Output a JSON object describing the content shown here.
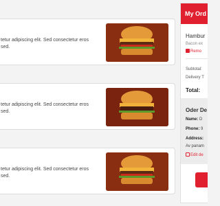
{
  "products": [
    {
      "description": "tetur adipiscing elit. Sed consectetur eros\nsed.",
      "image_icon": "burger-image"
    },
    {
      "description": "tetur adipiscing elit. Sed consectetur eros\nsed.",
      "image_icon": "burger-image"
    },
    {
      "description": "tetur adipiscing elit. Sed consectetur eros\nsed.",
      "image_icon": "burger-image"
    }
  ],
  "order": {
    "title": "My Ord",
    "item_name": "Hambur",
    "item_sub": "Bacon ex",
    "remove_label": "Remo",
    "subtotal_label": "Subtotal:",
    "delivery_label": "Delivery T",
    "total_label": "Total:"
  },
  "order_details": {
    "title": "Oder De",
    "name_label": "Name:",
    "name_value": "D",
    "phone_label": "Phone:",
    "phone_value": "9",
    "address_label": "Address:",
    "address_value": "Av panam",
    "edit_label": "Edit de"
  },
  "colors": {
    "accent": "#e0202f"
  }
}
